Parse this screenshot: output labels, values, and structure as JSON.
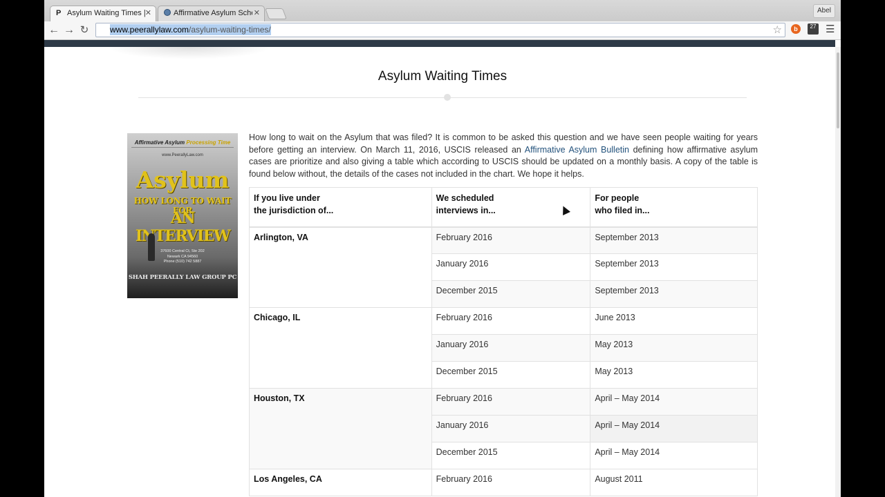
{
  "browser": {
    "tabs": [
      {
        "favicon": "P",
        "title": "Asylum Waiting Times | Sa"
      },
      {
        "favicon": "seal",
        "title": "Affirmative Asylum Schedu"
      }
    ],
    "user": "Abel",
    "url_host": "www.peerallylaw.com",
    "url_path": "/asylum-waiting-times/",
    "ext_badge": "27"
  },
  "page": {
    "title": "Asylum Waiting Times",
    "book": {
      "header_a": "Affirmative Asylum",
      "header_b": "Processing Time",
      "url": "www.PeerallyLaw.com",
      "big": "Asylum",
      "sub": "HOW LONG TO WAIT FOR",
      "sub2": "AN INTERVIEW",
      "addr1": "37600 Central Ct, Ste 202",
      "addr2": "Newark CA 94560",
      "addr3": "Phone (510) 742 5887",
      "firm": "SHAH PEERALLY LAW GROUP PC"
    },
    "intro_before": "How long to wait on the Asylum that was filed? It is common to be asked this question and we have seen people waiting for years before getting an interview. On March 11, 2016, USCIS released an ",
    "intro_link": "Affirmative Asylum Bulletin",
    "intro_after": " defining how affirmative asylum cases are prioritize and also giving a table which according to USCIS should be updated on a monthly basis. A copy of the table is found below without, the details of the cases not included in the chart. We hope it helps.",
    "table": {
      "headers": [
        [
          "If you live under",
          "the jurisdiction of..."
        ],
        [
          "We scheduled",
          "interviews in..."
        ],
        [
          "For people",
          "who filed in..."
        ]
      ],
      "groups": [
        {
          "city": "Arlington, VA",
          "rows": [
            [
              "February 2016",
              "September 2013"
            ],
            [
              "January 2016",
              "September 2013"
            ],
            [
              "December 2015",
              "September 2013"
            ]
          ]
        },
        {
          "city": "Chicago, IL",
          "rows": [
            [
              "February 2016",
              "June 2013"
            ],
            [
              "January 2016",
              "May 2013"
            ],
            [
              "December 2015",
              "May 2013"
            ]
          ]
        },
        {
          "city": "Houston, TX",
          "rows": [
            [
              "February 2016",
              "April – May 2014"
            ],
            [
              "January 2016",
              "April – May 2014"
            ],
            [
              "December 2015",
              "April – May 2014"
            ]
          ]
        },
        {
          "city": "Los Angeles, CA",
          "rows": [
            [
              "February 2016",
              "August 2011"
            ]
          ]
        }
      ]
    }
  }
}
